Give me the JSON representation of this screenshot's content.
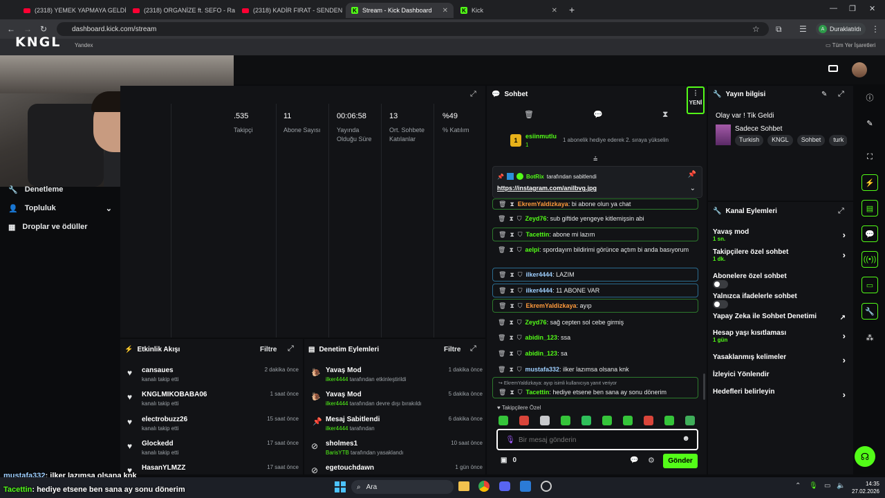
{
  "browser": {
    "tabs": [
      {
        "label": "(2318) YEMEK YAPMAYA GELDİ",
        "kind": "yt"
      },
      {
        "label": "(2318) ORGANİZE ft. SEFO - Ra",
        "kind": "yt"
      },
      {
        "label": "(2318) KADİR FIRAT - SENDEN",
        "kind": "yt"
      },
      {
        "label": "Stream - Kick Dashboard",
        "kind": "kick"
      },
      {
        "label": "Kick",
        "kind": "kick"
      }
    ],
    "url": "dashboard.kick.com/stream",
    "profile": "Duraklatıldı",
    "bookmarks": [
      "Yandex"
    ],
    "all_bookmarks": "Tüm Yer İşaretleri"
  },
  "overlay": {
    "logo": "KNGL"
  },
  "sidebar": {
    "items": [
      "Denetleme",
      "Topluluk",
      "Droplar ve ödüller"
    ]
  },
  "stats": [
    {
      "value": ".535",
      "label": "Takipçi"
    },
    {
      "value": "11",
      "label": "Abone Sayısı"
    },
    {
      "value": "00:06:58",
      "label": "Yayında Olduğu Süre"
    },
    {
      "value": "13",
      "label": "Ort. Sohbete Katılanlar"
    },
    {
      "value": "%49",
      "label": "% Katılım"
    }
  ],
  "activity": {
    "title": "Etkinlik Akışı",
    "filter": "Filtre",
    "items": [
      {
        "name": "cansaues",
        "sub": "kanalı takip etti",
        "time": "2 dakika önce"
      },
      {
        "name": "KNGLMIKOBABA06",
        "sub": "kanalı takip etti",
        "time": "1 saat önce"
      },
      {
        "name": "electrobuzz26",
        "sub": "kanalı takip etti",
        "time": "15 saat önce"
      },
      {
        "name": "Glockedd",
        "sub": "kanalı takip etti",
        "time": "17 saat önce"
      },
      {
        "name": "HasanYLMZZ",
        "sub": "",
        "time": "17 saat önce"
      }
    ]
  },
  "moderation": {
    "title": "Denetim Eylemleri",
    "filter": "Filtre",
    "items": [
      {
        "name": "Yavaş Mod",
        "user": "ilker4444",
        "sub": "tarafından etkinleştirildi",
        "time": "1 dakika önce"
      },
      {
        "name": "Yavaş Mod",
        "user": "ilker4444",
        "sub": "tarafından devre dışı bırakıldı",
        "time": "5 dakika önce"
      },
      {
        "name": "Mesaj Sabitlendi",
        "user": "ilker4444",
        "sub": "tarafından",
        "time": "6 dakika önce"
      },
      {
        "name": "sholmes1",
        "user": "BarisYTB",
        "sub": "tarafından yasaklandı",
        "time": "10 saat önce"
      },
      {
        "name": "egetouchdawn",
        "user": "",
        "sub": "",
        "time": "1 gün önce"
      }
    ]
  },
  "chat": {
    "title": "Sohbet",
    "new_badge": "YENİ",
    "gift": {
      "user": "esiinmutlu",
      "count": "1",
      "text": "1 abonelik hediye ederek 2. sıraya yükselin"
    },
    "pinned": {
      "by": "BotRix",
      "by_text": "tarafından sabitlendi",
      "link": "https://instagram.com/anilbvg.jpg"
    },
    "messages": [
      {
        "user": "EkremYaldizkaya",
        "text": "bi abone olun ya chat",
        "color": "#ff9a3c"
      },
      {
        "user": "Zeyd76",
        "text": "sub giftide yengeye kitlemişsin abi",
        "color": "#53fc18"
      },
      {
        "user": "Tacettin",
        "text": "abone mi lazım",
        "color": "#53fc18"
      },
      {
        "user": "aelpi",
        "text": "spordayım bildirimi görünce açtım bi anda basıyorum",
        "color": "#53fc18"
      },
      {
        "user": "ilker4444",
        "text": "LAZIM",
        "color": "#9ecfff"
      },
      {
        "user": "ilker4444",
        "text": "11 ABONE VAR",
        "color": "#9ecfff"
      },
      {
        "user": "EkremYaldizkaya",
        "text": "ayıp",
        "color": "#ff9a3c"
      },
      {
        "user": "Zeyd76",
        "text": "sağ cepten sol cebe girmiş",
        "color": "#53fc18"
      },
      {
        "user": "abidin_123",
        "text": "ssa",
        "color": "#53fc18"
      },
      {
        "user": "abidin_123",
        "text": "sa",
        "color": "#53fc18"
      },
      {
        "user": "mustafa332",
        "text": "ilker lazımsa olsana knk",
        "color": "#9ecfff"
      },
      {
        "user": "Tacettin",
        "text": "hediye etsene ben sana ay sonu dönerim",
        "color": "#53fc18"
      }
    ],
    "reply_hint": "EkremYaldizkaya: ayıp isimli kullanıcıya yanıt veriyor",
    "followers_only": "Takipçilere Özel",
    "placeholder": "Bir mesaj gönderin",
    "points": "0",
    "send": "Gönder"
  },
  "stream_info": {
    "title": "Yayın bilgisi",
    "stream_title": "Olay var ! Tik Geldi",
    "category": "Sadece Sohbet",
    "tags": [
      "Turkish",
      "KNGL",
      "Sohbet",
      "turk"
    ]
  },
  "channel_actions": {
    "title": "Kanal Eylemleri",
    "items": [
      {
        "label": "Yavaş mod",
        "sub": "1 sn.",
        "control": "chevron"
      },
      {
        "label": "Takipçilere özel sohbet",
        "sub": "1 dk.",
        "control": "chevron"
      },
      {
        "label": "Abonelere özel sohbet",
        "sub": "",
        "control": "toggle"
      },
      {
        "label": "Yalnızca ifadelerle sohbet",
        "sub": "",
        "control": "toggle"
      },
      {
        "label": "Yapay Zeka ile Sohbet Denetimi",
        "sub": "",
        "control": "external"
      },
      {
        "label": "Hesap yaşı kısıtlaması",
        "sub": "1 gün",
        "control": "chevron"
      },
      {
        "label": "Yasaklanmış kelimeler",
        "sub": "",
        "control": "chevron"
      },
      {
        "label": "İzleyici Yönlendir",
        "sub": "",
        "control": "none"
      },
      {
        "label": "Hedefleri belirleyin",
        "sub": "",
        "control": "chevron"
      }
    ]
  },
  "overlay_chat": [
    {
      "user": "mustafa332",
      "text": ": ilker lazımsa olsana knk",
      "color": "#9ecfff"
    },
    {
      "user": "Tacettin",
      "text": ": hediye etsene ben sana ay sonu dönerim",
      "color": "#53fc18"
    }
  ],
  "taskbar": {
    "search": "Ara",
    "time": "14:35",
    "date": "27.02.2026"
  }
}
